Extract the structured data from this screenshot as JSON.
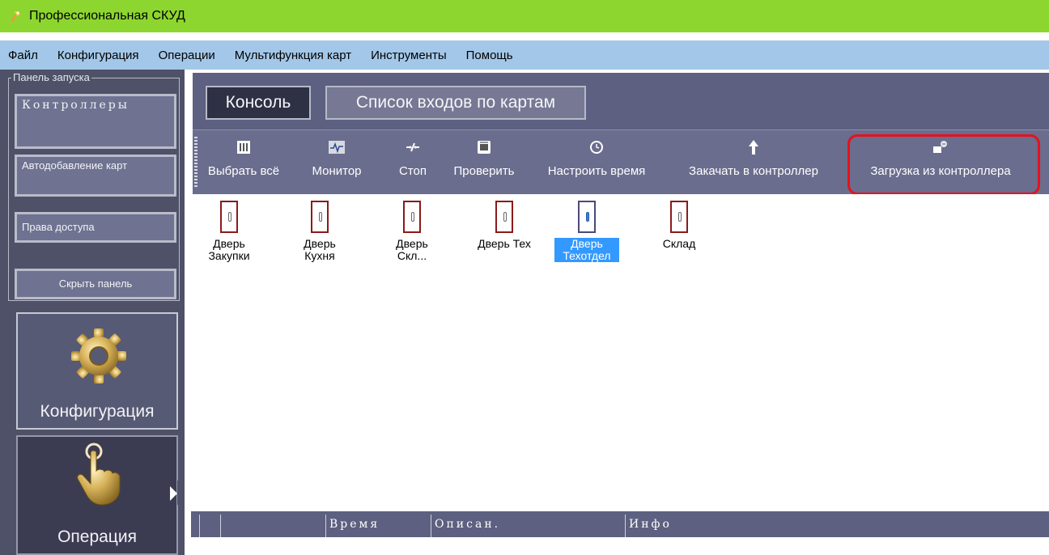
{
  "window": {
    "title": "Профессиональная СКУД"
  },
  "menu": [
    "Файл",
    "Конфигурация",
    "Операции",
    "Мультифункция карт",
    "Инструменты",
    "Помощь"
  ],
  "launch_panel": {
    "legend": "Панель запуска",
    "buttons": [
      "Контроллеры",
      "Автодобавление карт",
      "Права доступа",
      "Скрыть панель"
    ]
  },
  "sections": {
    "config_label": "Конфигурация",
    "ops_label": "Операция"
  },
  "tabs": [
    "Консоль",
    "Список входов по картам"
  ],
  "toolbar": {
    "items": [
      "Выбрать всё",
      "Монитор",
      "Стоп",
      "Проверить",
      "Настроить время",
      "Закачать в контроллер",
      "Загрузка из контроллера"
    ]
  },
  "doors": [
    {
      "label": "Дверь Закупки"
    },
    {
      "label": "Дверь Кухня"
    },
    {
      "label": "Дверь Скл..."
    },
    {
      "label": "Дверь Тех"
    },
    {
      "label": "Дверь Техотдел",
      "selected": true
    },
    {
      "label": "Склад"
    }
  ],
  "log": {
    "columns": [
      "Время",
      "Описан.",
      "Инфо"
    ]
  },
  "colors": {
    "titlebar": "#8dd62f",
    "menubar": "#a3c7e8",
    "panel": "#4f5168",
    "highlight": "#e8101c",
    "selection": "#3399ff"
  }
}
